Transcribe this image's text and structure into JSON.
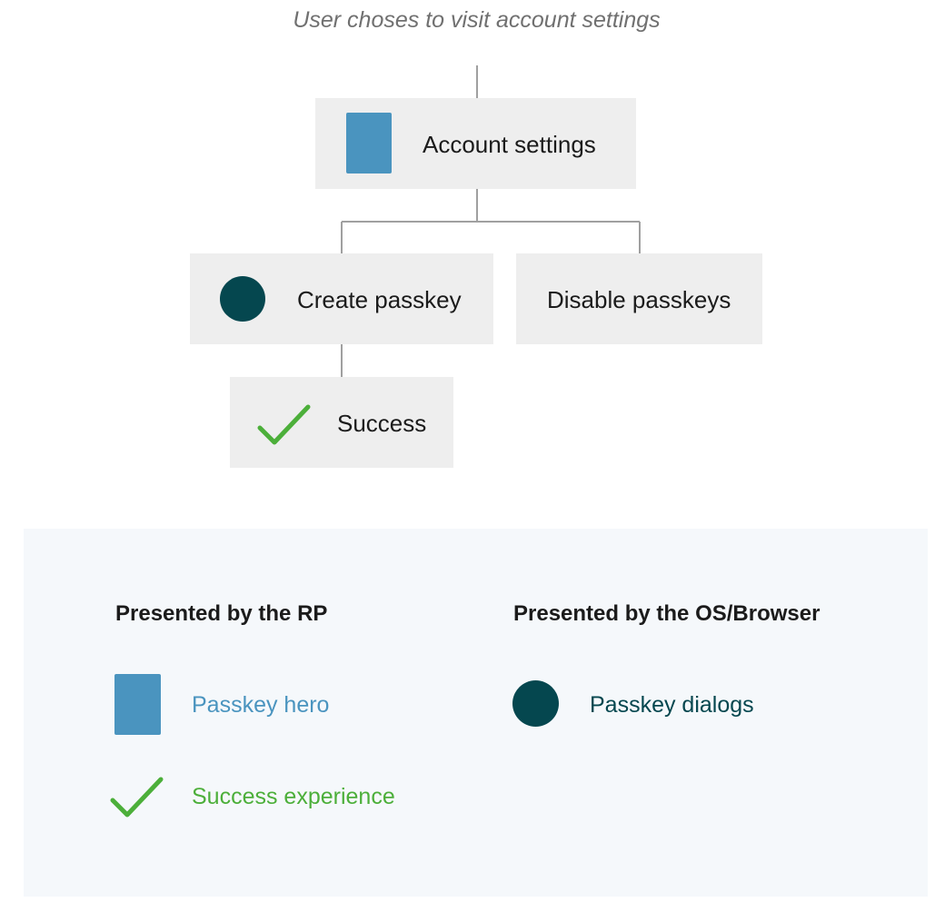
{
  "caption": "User choses to visit account settings",
  "flow": {
    "account_settings": {
      "label": "Account settings",
      "icon": "passkey-hero-rect-icon"
    },
    "create_passkey": {
      "label": "Create passkey",
      "icon": "passkey-dialog-circle-icon"
    },
    "disable_passkeys": {
      "label": "Disable passkeys"
    },
    "success": {
      "label": "Success",
      "icon": "checkmark-icon"
    }
  },
  "legend": {
    "rp_heading": "Presented by the RP",
    "os_heading": "Presented by the OS/Browser",
    "items": [
      {
        "label": "Passkey hero",
        "icon": "rect-icon",
        "color": "#4a94bf"
      },
      {
        "label": "Success experience",
        "icon": "check-icon",
        "color": "#4caf3a"
      },
      {
        "label": "Passkey dialogs",
        "icon": "circle-icon",
        "color": "#05474f"
      }
    ]
  },
  "colors": {
    "hero_blue": "#4a94bf",
    "dialog_teal": "#05474f",
    "success_green": "#4caf3a",
    "node_bg": "#eeeeee",
    "legend_bg": "#f5f8fb",
    "connector": "#a0a0a0"
  }
}
